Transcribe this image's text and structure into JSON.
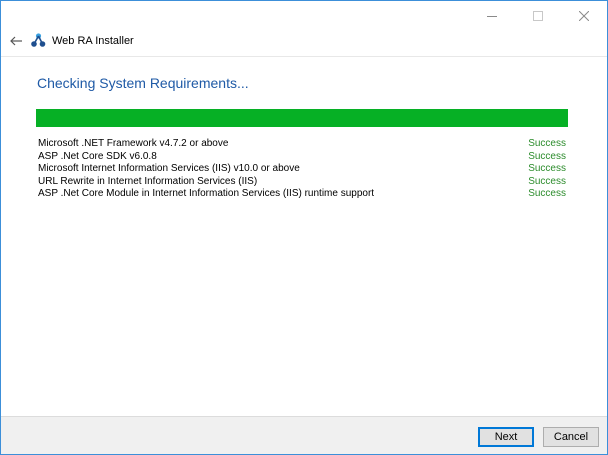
{
  "window": {
    "title": "Web RA Installer",
    "controls": [
      "minimize-icon",
      "maximize-icon",
      "close-icon"
    ]
  },
  "page": {
    "heading": "Checking System Requirements...",
    "progress": 1.0,
    "progress_color": "#06b025",
    "heading_color": "#1f5aa6",
    "success_color": "#2c8c2c"
  },
  "requirements": [
    {
      "name": "Microsoft .NET Framework v4.7.2 or above",
      "status": "Success"
    },
    {
      "name": "ASP .Net Core SDK v6.0.8",
      "status": "Success"
    },
    {
      "name": "Microsoft Internet Information Services (IIS) v10.0 or above",
      "status": "Success"
    },
    {
      "name": "URL Rewrite in Internet Information Services (IIS)",
      "status": "Success"
    },
    {
      "name": "ASP .Net Core Module in Internet Information Services (IIS) runtime support",
      "status": "Success"
    }
  ],
  "footer": {
    "next_label": "Next",
    "cancel_label": "Cancel"
  }
}
